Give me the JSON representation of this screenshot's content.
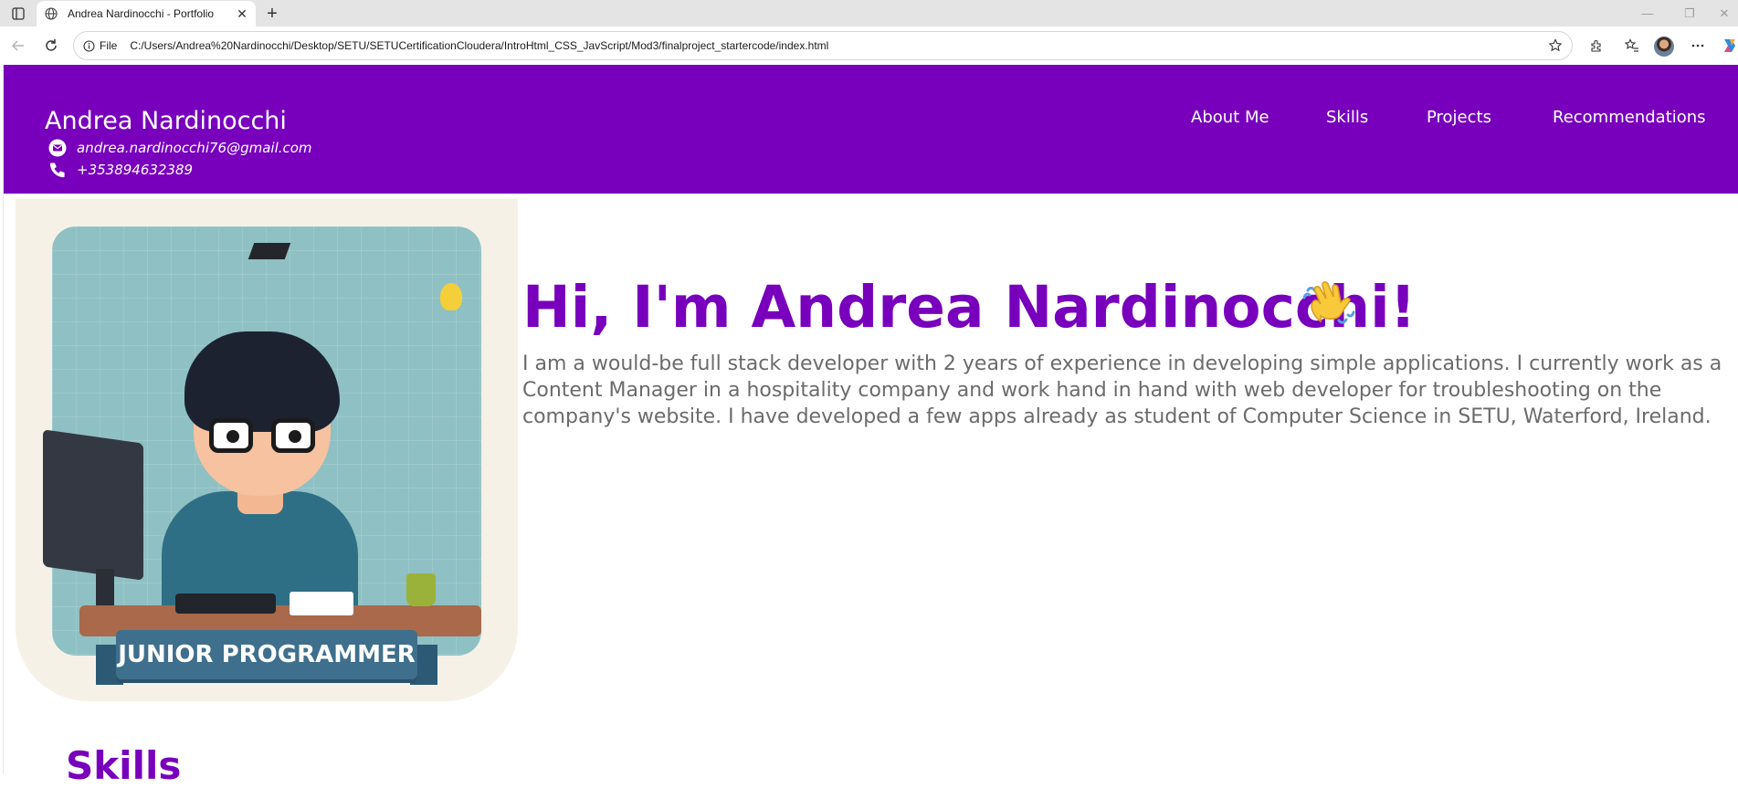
{
  "browser": {
    "tab_title": "Andrea Nardinocchi - Portfolio",
    "new_tab_label": "+",
    "file_label": "File",
    "url": "C:/Users/Andrea%20Nardinocchi/Desktop/SETU/SETUCertificationCloudera/IntroHtml_CSS_JavScript/Mod3/finalproject_startercode/index.html"
  },
  "header": {
    "name": "Andrea Nardinocchi",
    "email": "andrea.nardinocchi76@gmail.com",
    "phone": "+353894632389",
    "nav": [
      "About Me",
      "Skills",
      "Projects",
      "Recommendations"
    ]
  },
  "hero": {
    "image_banner": "JUNIOR PROGRAMMER",
    "title": "Hi, I'm Andrea Nardinocchi!",
    "description": "I am a would-be full stack developer with 2 years of experience in developing simple applications. I currently work as a Content Manager in a hospitality company and work hand in hand with web developer for troubleshooting on the company's website. I have developed a few apps already as student of Computer Science in SETU, Waterford, Ireland."
  },
  "skills": {
    "title": "Skills"
  },
  "colors": {
    "brand_purple": "#7800bd",
    "text_gray": "#6b6b6b"
  }
}
